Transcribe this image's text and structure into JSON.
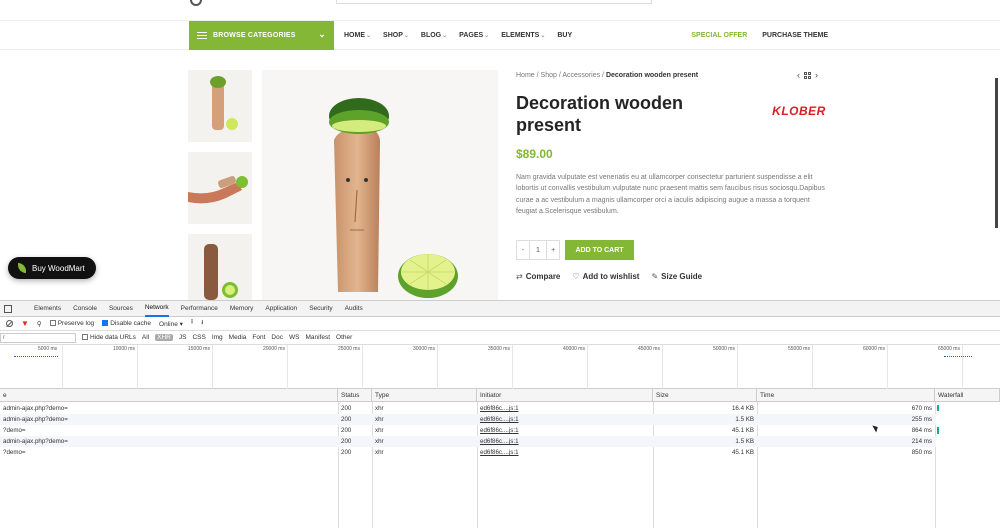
{
  "site": {
    "browse_label": "BROWSE CATEGORIES",
    "menu": [
      {
        "label": "HOME",
        "caret": true
      },
      {
        "label": "SHOP",
        "caret": true
      },
      {
        "label": "BLOG",
        "caret": true
      },
      {
        "label": "PAGES",
        "caret": true
      },
      {
        "label": "ELEMENTS",
        "caret": true
      },
      {
        "label": "BUY",
        "caret": false
      }
    ],
    "special_offer": "SPECIAL OFFER",
    "purchase_theme": "PURCHASE THEME",
    "breadcrumb": {
      "home": "Home",
      "shop": "Shop",
      "category": "Accessories",
      "current": "Decoration wooden present"
    },
    "product": {
      "title": "Decoration wooden present",
      "price": "$89.00",
      "brand": "KLOBER",
      "description": "Nam gravida vulputate est venenatis eu at ullamcorper consectetur parturient suspendisse a elit lobortis ut convallis vestibulum vulputate nunc praesent mattis sem faucibus risus sociosqu.Dapibus curae a ac vestibulum a magnis ullamcorper orci a iaculis adipiscing augue a massa a torquent feugiat a.Scelerisque vestibulum.",
      "qty_minus": "-",
      "qty_value": "1",
      "qty_plus": "+",
      "add_to_cart": "ADD TO CART",
      "compare": "Compare",
      "wishlist": "Add to wishlist",
      "size_guide": "Size Guide"
    },
    "buy_button": "Buy WoodMart",
    "accent_color": "#83b735"
  },
  "devtools": {
    "tabs": [
      "Elements",
      "Console",
      "Sources",
      "Network",
      "Performance",
      "Memory",
      "Application",
      "Security",
      "Audits"
    ],
    "active_tab": "Network",
    "toolbar": {
      "preserve_log": "Preserve log",
      "disable_cache": "Disable cache",
      "throttle": "Online"
    },
    "filter": {
      "placeholder": "r",
      "hide_data_urls": "Hide data URLs",
      "types": [
        "All",
        "XHR",
        "JS",
        "CSS",
        "Img",
        "Media",
        "Font",
        "Doc",
        "WS",
        "Manifest",
        "Other"
      ],
      "active_type": "XHR"
    },
    "timeline_ticks": [
      "5000 ms",
      "10000 ms",
      "15000 ms",
      "20000 ms",
      "25000 ms",
      "30000 ms",
      "35000 ms",
      "40000 ms",
      "45000 ms",
      "50000 ms",
      "55000 ms",
      "60000 ms",
      "65000 ms"
    ],
    "columns": [
      "e",
      "Status",
      "Type",
      "Initiator",
      "Size",
      "Time",
      "Waterfall"
    ],
    "rows": [
      {
        "name": "admin-ajax.php?demo=",
        "status": "200",
        "type": "xhr",
        "initiator": "ed6f86c....js:1",
        "size": "16.4 KB",
        "time": "670 ms"
      },
      {
        "name": "admin-ajax.php?demo=",
        "status": "200",
        "type": "xhr",
        "initiator": "ed6f86c....js:1",
        "size": "1.5 KB",
        "time": "255 ms"
      },
      {
        "name": "?demo=",
        "status": "200",
        "type": "xhr",
        "initiator": "ed6f86c....js:1",
        "size": "45.1 KB",
        "time": "864 ms"
      },
      {
        "name": "admin-ajax.php?demo=",
        "status": "200",
        "type": "xhr",
        "initiator": "ed6f86c....js:1",
        "size": "1.5 KB",
        "time": "214 ms"
      },
      {
        "name": "?demo=",
        "status": "200",
        "type": "xhr",
        "initiator": "ed6f86c....js:1",
        "size": "45.1 KB",
        "time": "850 ms"
      }
    ]
  }
}
